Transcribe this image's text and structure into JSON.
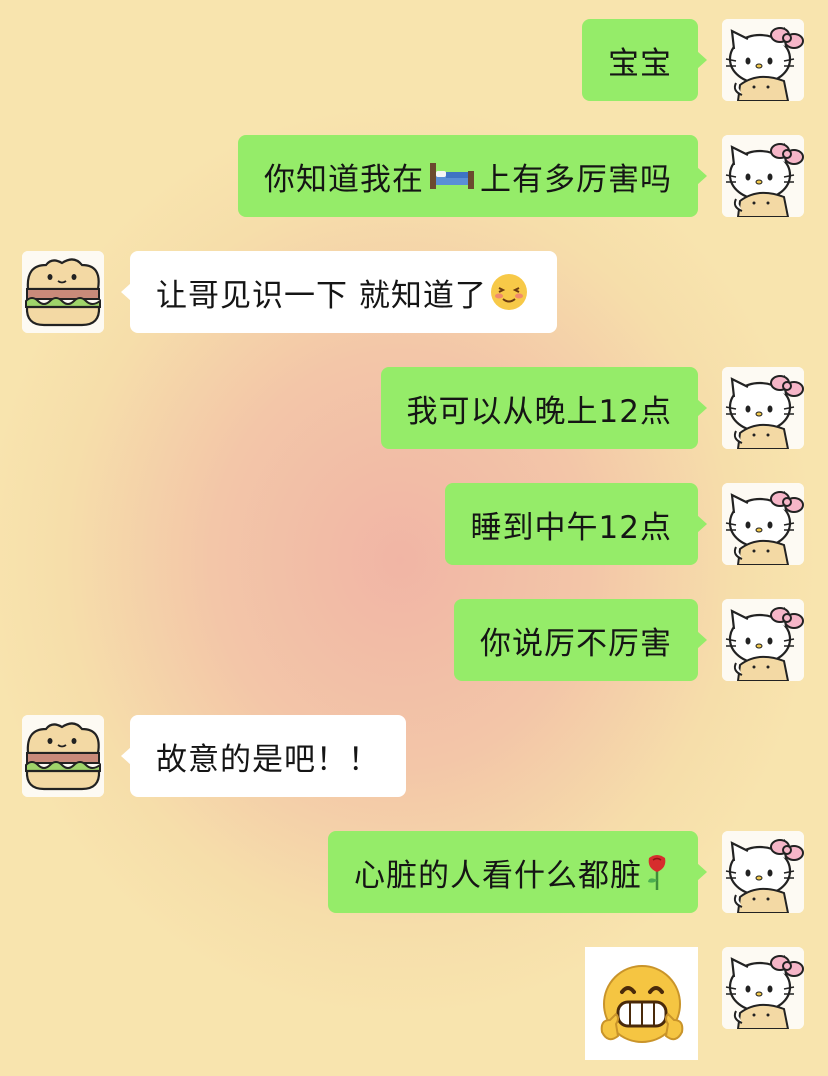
{
  "messages": [
    {
      "side": "out",
      "text": "宝宝"
    },
    {
      "side": "out",
      "text_before": "你知道我在",
      "emoji": "bed-emoji",
      "text_after": "上有多厉害吗"
    },
    {
      "side": "in",
      "text": "让哥见识一下 就知道了",
      "emoji": "blush-smile-emoji"
    },
    {
      "side": "out",
      "text": "我可以从晚上12点"
    },
    {
      "side": "out",
      "text": "睡到中午12点"
    },
    {
      "side": "out",
      "text": "你说厉不厉害"
    },
    {
      "side": "in",
      "text": "故意的是吧！！"
    },
    {
      "side": "out",
      "text": "心脏的人看什么都脏",
      "emoji": "rose-emoji"
    },
    {
      "side": "out",
      "sticker": "grinning-thumbs-sticker"
    }
  ],
  "avatars": {
    "me": "hello-kitty-avatar",
    "other": "sandwich-bear-avatar"
  },
  "colors": {
    "outgoing_bubble": "#95ec69",
    "incoming_bubble": "#ffffff",
    "text": "#151515"
  }
}
